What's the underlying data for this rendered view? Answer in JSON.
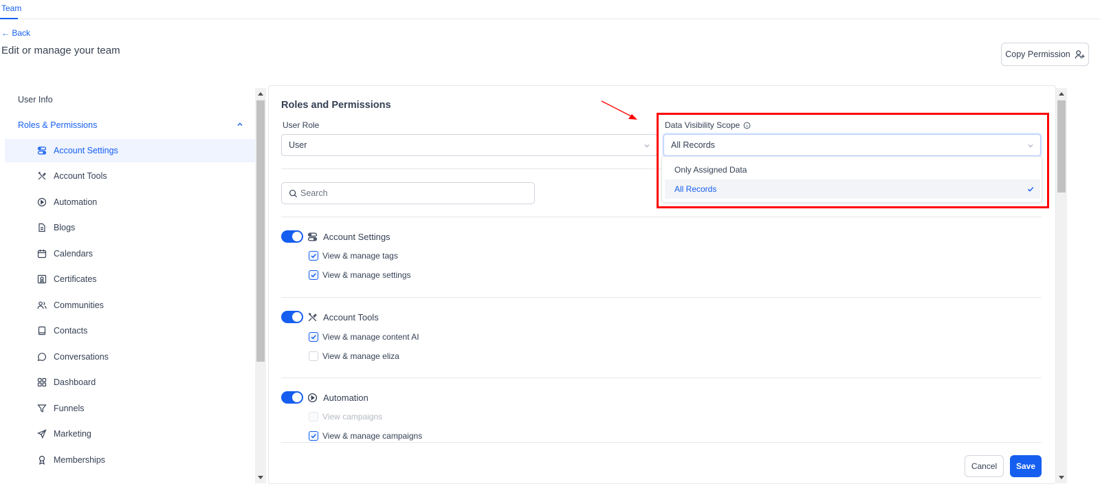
{
  "top_tab": "Team",
  "back_label": "← Back",
  "page_title": "Edit or manage your team",
  "copy_permission_label": "Copy Permission",
  "sidebar": {
    "user_info": "User Info",
    "roles_permissions": "Roles & Permissions",
    "items": [
      {
        "label": "Account Settings",
        "icon": "toggles-icon"
      },
      {
        "label": "Account Tools",
        "icon": "tools-icon"
      },
      {
        "label": "Automation",
        "icon": "play-circle-icon"
      },
      {
        "label": "Blogs",
        "icon": "document-icon"
      },
      {
        "label": "Calendars",
        "icon": "calendar-icon"
      },
      {
        "label": "Certificates",
        "icon": "certificate-icon"
      },
      {
        "label": "Communities",
        "icon": "users-icon"
      },
      {
        "label": "Contacts",
        "icon": "contacts-book-icon"
      },
      {
        "label": "Conversations",
        "icon": "chat-bubble-icon"
      },
      {
        "label": "Dashboard",
        "icon": "grid-icon"
      },
      {
        "label": "Funnels",
        "icon": "funnel-icon"
      },
      {
        "label": "Marketing",
        "icon": "send-icon"
      },
      {
        "label": "Memberships",
        "icon": "award-icon"
      }
    ]
  },
  "panel": {
    "title": "Roles and Permissions",
    "user_role_label": "User Role",
    "user_role_value": "User",
    "scope_label": "Data Visibility Scope",
    "scope_value": "All Records",
    "scope_options": [
      "Only Assigned Data",
      "All Records"
    ],
    "search_placeholder": "Search",
    "sections": [
      {
        "title": "Account Settings",
        "perms": [
          {
            "label": "View & manage tags"
          },
          {
            "label": "View & manage settings"
          }
        ]
      },
      {
        "title": "Account Tools",
        "perms": [
          {
            "label": "View & manage content AI"
          },
          {
            "label": "View & manage eliza"
          }
        ]
      },
      {
        "title": "Automation",
        "perms": [
          {
            "label": "View campaigns"
          },
          {
            "label": "View & manage campaigns"
          }
        ]
      }
    ],
    "cancel_label": "Cancel",
    "save_label": "Save"
  },
  "colors": {
    "accent": "#155eef",
    "annotation": "#ff0000"
  }
}
